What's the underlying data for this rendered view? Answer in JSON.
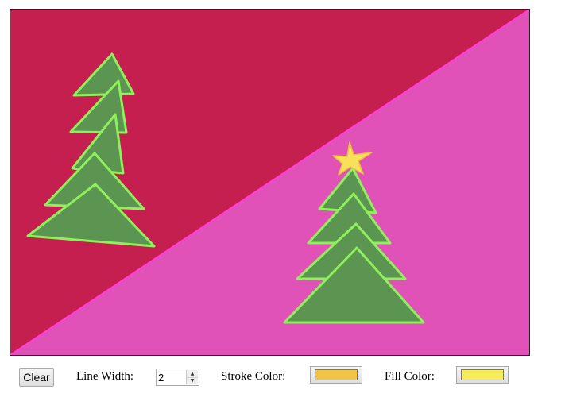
{
  "canvas": {
    "background_top_color": "#c51f4f",
    "background_bottom_color": "#e152b9",
    "divider_color": "#ff3ee0",
    "tree_fill_color": "#5c9552",
    "tree_stroke_color": "#8ef05a",
    "star_fill_color": "#f7e05a",
    "star_stroke_color": "#f0c040"
  },
  "toolbar": {
    "clear_label": "Clear",
    "line_width_label": "Line Width:",
    "line_width_value": "2",
    "stroke_color_label": "Stroke Color:",
    "stroke_color_value": "#f2c445",
    "fill_color_label": "Fill Color:",
    "fill_color_value": "#f7ed5a"
  }
}
